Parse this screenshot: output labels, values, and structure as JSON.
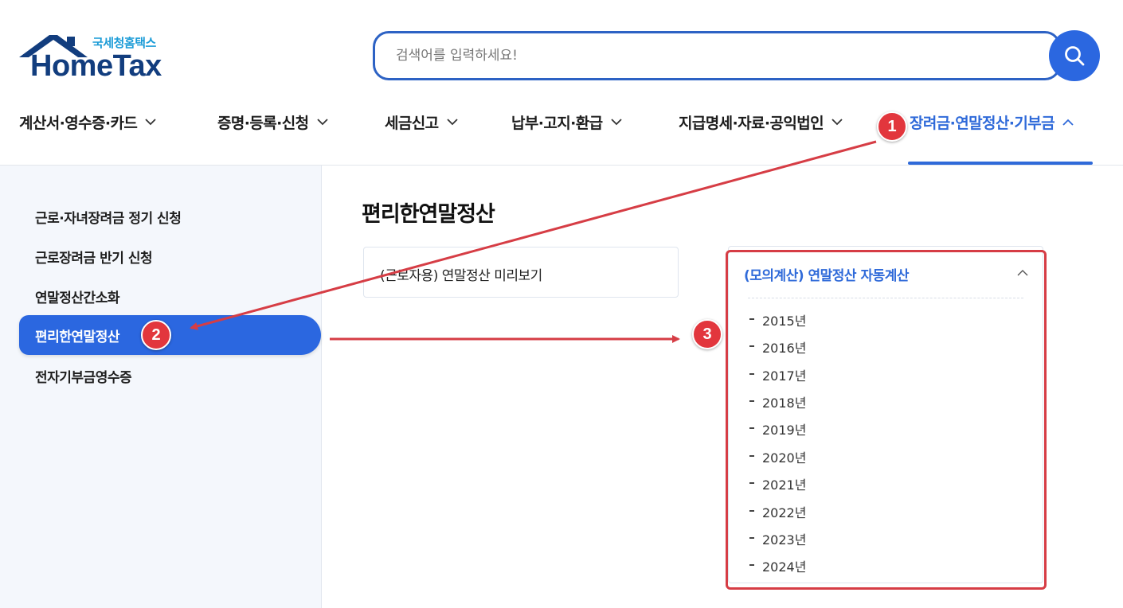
{
  "brand": {
    "sub": "국세청홈택스",
    "main": "HomeTax"
  },
  "search": {
    "placeholder": "검색어를 입력하세요!",
    "button_icon": "search-icon"
  },
  "gnb": {
    "items": [
      {
        "label": "계산서·영수증·카드"
      },
      {
        "label": "증명·등록·신청"
      },
      {
        "label": "세금신고"
      },
      {
        "label": "납부·고지·환급"
      },
      {
        "label": "지급명세·자료·공익법인"
      },
      {
        "label": "장려금·연말정산·기부금",
        "active": true
      }
    ]
  },
  "lnb": {
    "items": [
      {
        "label": "근로·자녀장려금 정기 신청"
      },
      {
        "label": "근로장려금 반기 신청"
      },
      {
        "label": "연말정산간소화"
      },
      {
        "label": "편리한연말정산",
        "active": true
      },
      {
        "label": "전자기부금영수증"
      }
    ]
  },
  "content": {
    "title": "편리한연말정산",
    "card1": {
      "label": "(근로자용) 연말정산 미리보기"
    },
    "accordion": {
      "title": "(모의계산) 연말정산 자동계산",
      "years": [
        "2015년",
        "2016년",
        "2017년",
        "2018년",
        "2019년",
        "2020년",
        "2021년",
        "2022년",
        "2023년",
        "2024년"
      ]
    }
  },
  "annotations": {
    "badges": [
      "1",
      "2",
      "3"
    ],
    "color": "#e2363d"
  },
  "colors": {
    "accent": "#2b67e0",
    "brand_navy": "#123d7e",
    "brand_sky": "#1a9bd7"
  }
}
